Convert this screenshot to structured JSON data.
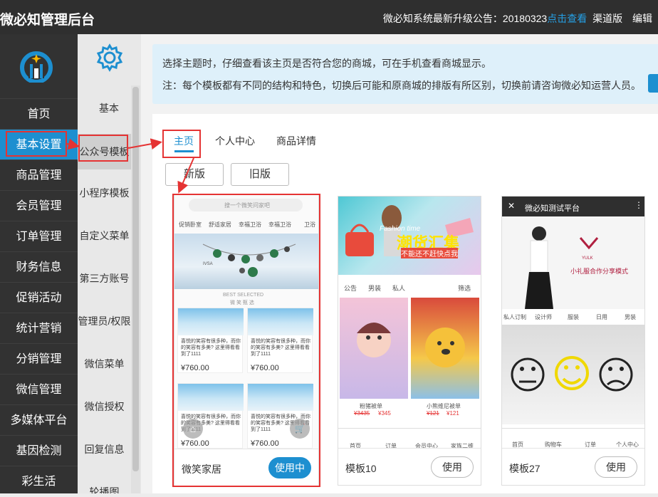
{
  "header": {
    "brand": "微必知管理后台",
    "notice_text": "微必知系统最新升级公告：20180323",
    "notice_link": "点击查看",
    "channel": "渠道版",
    "edit": "编辑"
  },
  "sidebar": {
    "items": [
      {
        "label": "首页"
      },
      {
        "label": "基本设置"
      },
      {
        "label": "商品管理"
      },
      {
        "label": "会员管理"
      },
      {
        "label": "订单管理"
      },
      {
        "label": "财务信息"
      },
      {
        "label": "促销活动"
      },
      {
        "label": "统计营销"
      },
      {
        "label": "分销管理"
      },
      {
        "label": "微信管理"
      },
      {
        "label": "多媒体平台"
      },
      {
        "label": "基因检测"
      },
      {
        "label": "彩生活"
      }
    ]
  },
  "subnav": {
    "title": "基本",
    "items": [
      {
        "label": "公众号模板"
      },
      {
        "label": "小程序模板"
      },
      {
        "label": "自定义菜单"
      },
      {
        "label": "第三方账号"
      },
      {
        "label": "管理员/权限"
      },
      {
        "label": "微信菜单"
      },
      {
        "label": "微信授权"
      },
      {
        "label": "回复信息"
      },
      {
        "label": "轮播图"
      }
    ]
  },
  "alert": {
    "line1": "选择主题时，仔细查看该主页是否符合您的商城，可在手机查看商城显示。",
    "line2": "注：每个模板都有不同的结构和特色，切换后可能和原商城的排版有所区别，切换前请咨询微必知运营人员。"
  },
  "tabs": [
    {
      "label": "主页"
    },
    {
      "label": "个人中心"
    },
    {
      "label": "商品详情"
    }
  ],
  "versions": {
    "new": "新版",
    "old": "旧版"
  },
  "templates": [
    {
      "name": "微笑家居",
      "button": "使用中",
      "preview": {
        "search_placeholder": "搜一个微笑问家吧",
        "categories": [
          "促销卧室",
          "舒适家居",
          "幸福卫浴",
          "幸福卫浴",
          "卫浴"
        ],
        "banner_caption": "IVSA",
        "section_title": "BEST SELECTED",
        "section_subtitle": "微 笑 甄 选",
        "product_text": "喜悦的笑容有很多种，而你的笑容有多美? 这里得看看到了1111",
        "price": "¥760.00"
      }
    },
    {
      "name": "模板10",
      "button": "使用",
      "preview": {
        "banner_en": "Fashion time",
        "banner_title": "潮货汇集",
        "banner_sub": "不能还不赶快点我",
        "filters": [
          "公告",
          "男装",
          "私人",
          "筛选"
        ],
        "products": [
          {
            "name": "粉猪被单",
            "old_price": "¥3435",
            "price": "¥345"
          },
          {
            "name": "小熊维尼被单",
            "old_price": "¥121",
            "price": "¥121"
          }
        ],
        "bottom_nav": [
          "首页",
          "订单",
          "会员中心",
          "家族二维"
        ]
      }
    },
    {
      "name": "模板27",
      "button": "使用",
      "preview": {
        "title": "微必知测试平台",
        "brand": "YULK",
        "slogan": "小礼服合作分享模式",
        "categories": [
          "私人订制",
          "设计师",
          "服装",
          "日用",
          "男装"
        ],
        "bottom_nav": [
          "首页",
          "购物车",
          "订单",
          "个人中心"
        ]
      }
    }
  ],
  "colors": {
    "topbar": "#2f2f2f",
    "sidebar": "#323232",
    "accent": "#1d8fd0",
    "highlight_box": "#e53333",
    "alert_bg": "#def0fa"
  }
}
